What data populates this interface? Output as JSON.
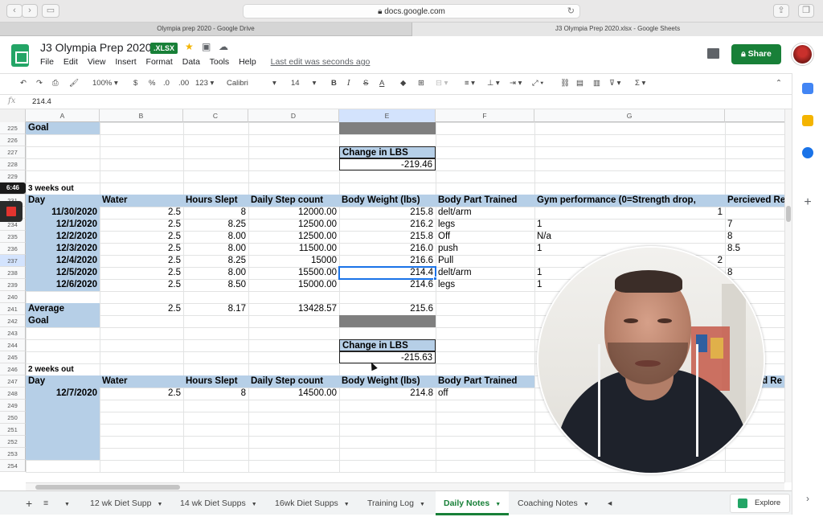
{
  "browser": {
    "url": "docs.google.com",
    "tabs": [
      {
        "title": "Olympia prep 2020 - Google Drive",
        "active": false
      },
      {
        "title": "J3 Olympia Prep 2020.xlsx - Google Sheets",
        "active": true
      }
    ]
  },
  "app": {
    "title": "J3 Olympia Prep 2020",
    "badge": ".XLSX",
    "menus": [
      "File",
      "Edit",
      "View",
      "Insert",
      "Format",
      "Data",
      "Tools",
      "Help"
    ],
    "last_edit": "Last edit was seconds ago",
    "share_label": "Share"
  },
  "toolbar": {
    "zoom": "100%",
    "currency": "$",
    "percent": "%",
    "dec_less": ".0",
    "dec_more": ".00",
    "format_more": "123",
    "font": "Calibri",
    "font_size": "14",
    "bold": "B",
    "italic": "I",
    "strike": "S",
    "text_color": "A"
  },
  "formula": {
    "fx": "fx",
    "value": "214.4"
  },
  "recorder": {
    "timer": "6:46"
  },
  "grid": {
    "columns": [
      "A",
      "B",
      "C",
      "D",
      "E",
      "F",
      "G"
    ],
    "selected_column": "E",
    "rows": [
      "225",
      "226",
      "227",
      "228",
      "229",
      "230",
      "231",
      "233",
      "234",
      "235",
      "236",
      "237",
      "238",
      "239",
      "240",
      "241",
      "242",
      "243",
      "244",
      "245",
      "246",
      "247",
      "248",
      "249",
      "250",
      "251",
      "252",
      "253",
      "254"
    ],
    "selected_row": "237",
    "goal_label_top": "Goal",
    "change_label_1": "Change in LBS",
    "change_value_1": "-219.46",
    "section_1": "3 weeks out",
    "headers": {
      "day": "Day",
      "water": "Water",
      "hours": "Hours Slept",
      "steps": "Daily Step count",
      "weight": "Body Weight (lbs)",
      "part": "Body Part Trained",
      "gym": "Gym performance (0=Strength drop,",
      "perceived": "Percieved Re",
      "perceived_short": "ed Re"
    },
    "week1": [
      {
        "day": "11/30/2020",
        "water": "2.5",
        "hours": "8",
        "steps": "12000.00",
        "weight": "215.8",
        "part": "delt/arm",
        "gym": "1",
        "gym_align": "right",
        "perceived": ""
      },
      {
        "day": "12/1/2020",
        "water": "2.5",
        "hours": "8.25",
        "steps": "12500.00",
        "weight": "216.2",
        "part": "legs",
        "gym": "1",
        "gym_align": "left",
        "perceived": "7"
      },
      {
        "day": "12/2/2020",
        "water": "2.5",
        "hours": "8.00",
        "steps": "12500.00",
        "weight": "215.8",
        "part": "Off",
        "gym": "N/a",
        "gym_align": "left",
        "perceived": "8"
      },
      {
        "day": "12/3/2020",
        "water": "2.5",
        "hours": "8.00",
        "steps": "11500.00",
        "weight": "216.0",
        "part": "push",
        "gym": "1",
        "gym_align": "left",
        "perceived": "8.5"
      },
      {
        "day": "12/4/2020",
        "water": "2.5",
        "hours": "8.25",
        "steps": "15000",
        "weight": "216.6",
        "part": "Pull",
        "gym": "2",
        "gym_align": "right",
        "perceived": ""
      },
      {
        "day": "12/5/2020",
        "water": "2.5",
        "hours": "8.00",
        "steps": "15500.00",
        "weight": "214.4",
        "part": "delt/arm",
        "gym": "1",
        "gym_align": "left",
        "perceived": "8"
      },
      {
        "day": "12/6/2020",
        "water": "2.5",
        "hours": "8.50",
        "steps": "15000.00",
        "weight": "214.6",
        "part": "legs",
        "gym": "1",
        "gym_align": "left",
        "perceived": ""
      }
    ],
    "average": {
      "label": "Average",
      "water": "2.5",
      "hours": "8.17",
      "steps": "13428.57",
      "weight": "215.6"
    },
    "goal_label": "Goal",
    "change_label_2": "Change in LBS",
    "change_value_2": "-215.63",
    "section_2": "2 weeks out",
    "week2": [
      {
        "day": "12/7/2020",
        "water": "2.5",
        "hours": "8",
        "steps": "14500.00",
        "weight": "214.8",
        "part": "off"
      }
    ]
  },
  "sheet_tabs": [
    {
      "label": "12 wk Diet Supp",
      "active": false
    },
    {
      "label": "14 wk Diet Supps",
      "active": false
    },
    {
      "label": "16wk Diet Supps",
      "active": false
    },
    {
      "label": "Training Log",
      "active": false
    },
    {
      "label": "Daily Notes",
      "active": true
    },
    {
      "label": "Coaching Notes",
      "active": false
    }
  ],
  "explore_label": "Explore",
  "colors": {
    "header_blue": "#b6cfe7",
    "goal_gray": "#7f7f7f",
    "sheets_green": "#188038",
    "selection_blue": "#1a73e8"
  }
}
